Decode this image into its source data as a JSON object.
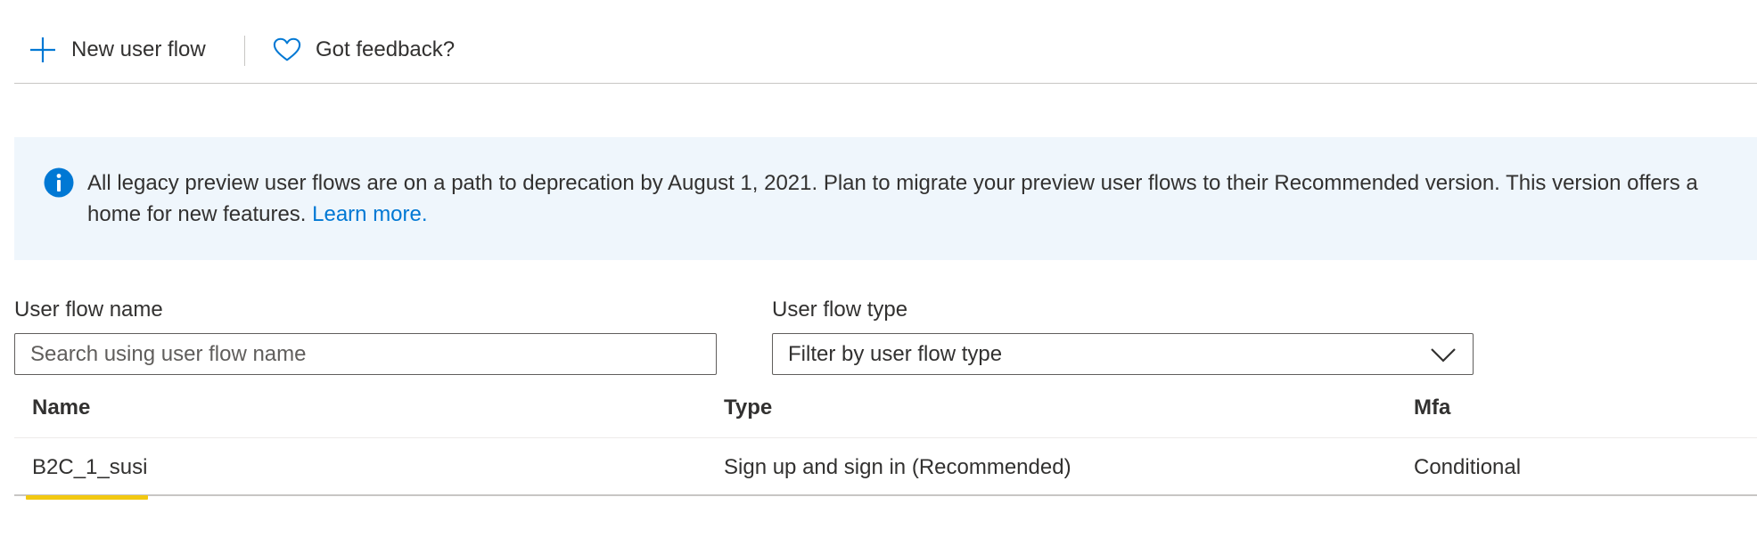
{
  "command_bar": {
    "new_user_flow_label": "New user flow",
    "feedback_label": "Got feedback?",
    "icons": [
      "plus-icon",
      "heart-icon"
    ]
  },
  "banner": {
    "message_line1": "All legacy preview user flows are on a path to deprecation by August 1, 2021. Plan to migrate your preview user flows to their Recommended version. This version offers a",
    "message_line2": "home for new features. ",
    "link_text": "Learn more.",
    "icon": "info-icon",
    "accent_color": "#0078d4",
    "background_color": "#eff6fc"
  },
  "filters": {
    "name_label": "User flow name",
    "name_placeholder": "Search using user flow name",
    "type_label": "User flow type",
    "type_value": "Filter by user flow type"
  },
  "table": {
    "columns": [
      "Name",
      "Type",
      "Mfa"
    ],
    "rows": [
      {
        "name": "B2C_1_susi",
        "type": "Sign up and sign in (Recommended)",
        "mfa": "Conditional"
      }
    ],
    "selection_color": "#f2c811"
  }
}
